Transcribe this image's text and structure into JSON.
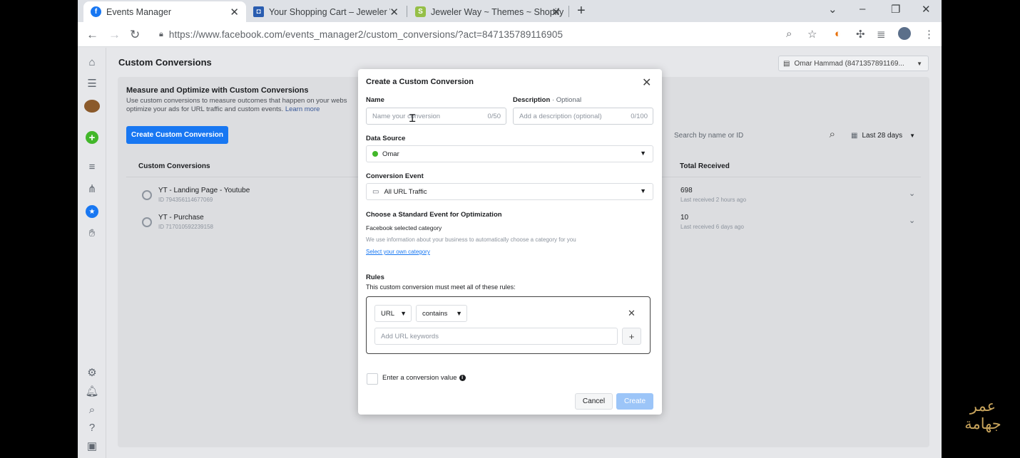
{
  "browser": {
    "tabs": [
      {
        "title": "Events Manager",
        "favicon": "facebook-icon",
        "color": "#1877f2"
      },
      {
        "title": "Your Shopping Cart – Jeweler Wa",
        "favicon": "shop-icon",
        "color": "#2a5db0"
      },
      {
        "title": "Jeweler Way ~ Themes ~ Shopify",
        "favicon": "shopify-icon",
        "color": "#95bf47"
      }
    ],
    "new_tab": "+",
    "url": "https://www.facebook.com/events_manager2/custom_conversions/?act=847135789116905"
  },
  "page": {
    "title": "Custom Conversions",
    "account": "Omar Hammad (8471357891169...",
    "intro_title": "Measure and Optimize with Custom Conversions",
    "intro_text": "Use custom conversions to measure outcomes that happen on your webs",
    "intro_text2": "optimize your ads for URL traffic and custom events.",
    "learn_more": "Learn more",
    "create_button": "Create Custom Conversion",
    "search_placeholder": "Search by name or ID",
    "date_range": "Last 28 days",
    "columns": {
      "name": "Custom Conversions",
      "total": "Total Received"
    },
    "rows": [
      {
        "name": "YT - Landing Page - Youtube",
        "id": "ID 794356114677069",
        "count": "698",
        "last": "Last received 2 hours ago"
      },
      {
        "name": "YT - Purchase",
        "id": "ID 717010592239158",
        "count": "10",
        "last": "Last received 6 days ago"
      }
    ]
  },
  "modal": {
    "title": "Create a Custom Conversion",
    "name_label": "Name",
    "name_placeholder": "Name your conversion",
    "name_count": "0/50",
    "desc_label": "Description",
    "desc_optional": " · Optional",
    "desc_placeholder": "Add a description (optional)",
    "desc_count": "0/100",
    "source_label": "Data Source",
    "source_value": "Omar",
    "source_color": "#42b72a",
    "event_label": "Conversion Event",
    "event_value": "All URL Traffic",
    "std_label": "Choose a Standard Event for Optimization",
    "std_category": "Facebook selected category",
    "std_info": "We use information about your business to automatically choose a category for you",
    "std_link": "Select your own category",
    "rules_label": "Rules",
    "rules_text": "This custom conversion must meet all of these rules:",
    "rule_field": "URL",
    "rule_operator": "contains",
    "rule_placeholder": "Add URL keywords",
    "value_label": "Enter a conversion value",
    "cancel": "Cancel",
    "create": "Create"
  },
  "watermark": {
    "line1": "عمر",
    "line2": "جهامة"
  }
}
